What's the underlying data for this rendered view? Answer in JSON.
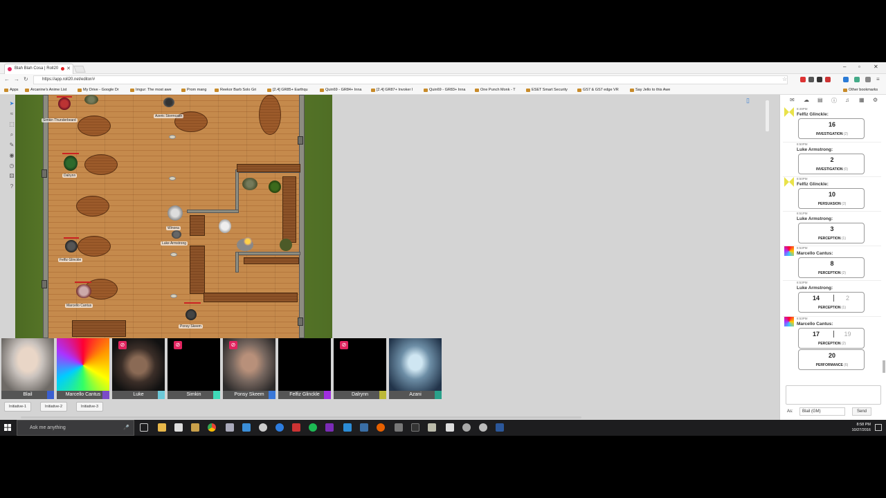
{
  "browser": {
    "tab_title": "Blah Blah Cosa | Roll20",
    "url": "https://app.roll20.net/editor/#",
    "bookmarks": [
      "Apps",
      "Arcanine's Anime List",
      "My Drive - Google Dr",
      "Imgur: The most awe",
      "Prom mang",
      "Reekor Barb Solo Gri",
      "[2.4] GR85+ Earthqu",
      "Quin69 - GR84+ Inna",
      "[2.4] GR87+ Invoker I",
      "Quin69 - GR83+ Inna",
      "One Punch Monk - T",
      "ESET Smart Security",
      "GS7 & GS7 edge VR",
      "Say Jello to this Awe"
    ],
    "other_bookmarks": "Other bookmarks"
  },
  "map": {
    "tokens": [
      {
        "name": "Simkin Thunderbeard"
      },
      {
        "name": "Azeric Stormcaith"
      },
      {
        "name": "Dalrynn"
      },
      {
        "name": "Winona"
      },
      {
        "name": "Luke Armstrong"
      },
      {
        "name": "Felfiz Glinckle"
      },
      {
        "name": "Marcello Cantus"
      },
      {
        "name": "Ponsy Skeem"
      }
    ]
  },
  "videos": [
    {
      "name": "Blail",
      "color": "#3a5fd0",
      "muted": false
    },
    {
      "name": "Marcello Cantus",
      "color": "#7b4ac7",
      "muted": false
    },
    {
      "name": "Luke",
      "color": "#6cc9d9",
      "muted": true
    },
    {
      "name": "Simkin",
      "color": "#3fd9b8",
      "muted": true
    },
    {
      "name": "Ponsy Skeem",
      "color": "#3a78d9",
      "muted": true
    },
    {
      "name": "Felfiz Glinckle",
      "color": "#a12ee0",
      "muted": true
    },
    {
      "name": "Dalrynn",
      "color": "#bcb838",
      "muted": true
    },
    {
      "name": "Azani",
      "color": "#2aa08a",
      "muted": false
    }
  ],
  "initiative_buttons": [
    "Initiative-1",
    "Initiative-2",
    "Initiative-3"
  ],
  "chat": {
    "messages": [
      {
        "time": "8:49PM",
        "who": "Felfiz Glinckle:",
        "value": "16",
        "value2": "",
        "label": "INVESTIGATION",
        "mod": "(2)"
      },
      {
        "time": "8:50PM",
        "who": "Luke Armstrong:",
        "value": "2",
        "value2": "",
        "label": "INVESTIGATION",
        "mod": "(0)"
      },
      {
        "time": "8:50PM",
        "who": "Felfiz Glinckle:",
        "value": "10",
        "value2": "",
        "label": "PERSUASION",
        "mod": "(2)"
      },
      {
        "time": "8:51PM",
        "who": "Luke Armstrong:",
        "value": "3",
        "value2": "",
        "label": "PERCEPTION",
        "mod": "(1)"
      },
      {
        "time": "8:53PM",
        "who": "Marcello Cantus:",
        "value": "8",
        "value2": "",
        "label": "PERCEPTION",
        "mod": "(2)"
      },
      {
        "time": "8:53PM",
        "who": "Luke Armstrong:",
        "value": "14",
        "value2": "2",
        "label": "PERCEPTION",
        "mod": "(1)"
      },
      {
        "time": "8:53PM",
        "who": "Marcello Cantus:",
        "value": "17",
        "value2": "19",
        "label": "PERCEPTION",
        "mod": "(2)"
      },
      {
        "time": "",
        "who": "",
        "value": "20",
        "value2": "",
        "label": "PERFORMANCE",
        "mod": "(6)"
      }
    ],
    "as_label": "As:",
    "as_value": "Blail (GM)",
    "send_label": "Send"
  },
  "taskbar": {
    "search_placeholder": "Ask me anything",
    "time": "8:58 PM",
    "date": "10/27/2016"
  }
}
